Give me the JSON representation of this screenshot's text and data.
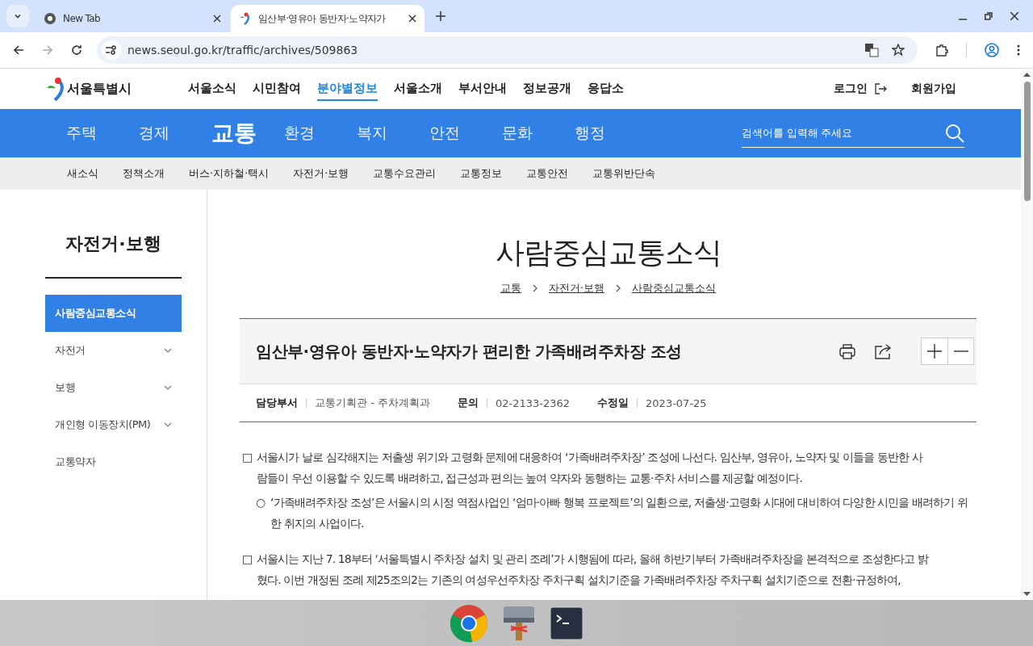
{
  "browser": {
    "tabs": [
      {
        "title": "New Tab",
        "selected": false,
        "kind": "new-tab"
      },
      {
        "title": "임산부·영유아 동반자·노약자가",
        "selected": true,
        "kind": "page"
      }
    ],
    "url": "news.seoul.go.kr/traffic/archives/509863"
  },
  "header": {
    "logo": "서울특별시",
    "nav": [
      {
        "label": "서울소식",
        "selected": false
      },
      {
        "label": "시민참여",
        "selected": false
      },
      {
        "label": "분야별정보",
        "selected": true
      },
      {
        "label": "서울소개",
        "selected": false
      },
      {
        "label": "부서안내",
        "selected": false
      },
      {
        "label": "정보공개",
        "selected": false
      },
      {
        "label": "응답소",
        "selected": false
      }
    ],
    "login": "로그인",
    "signup": "회원가입"
  },
  "category_nav": {
    "items": [
      {
        "label": "주택",
        "selected": false
      },
      {
        "label": "경제",
        "selected": false
      },
      {
        "label": "교통",
        "selected": true
      },
      {
        "label": "환경",
        "selected": false
      },
      {
        "label": "복지",
        "selected": false
      },
      {
        "label": "안전",
        "selected": false
      },
      {
        "label": "문화",
        "selected": false
      },
      {
        "label": "행정",
        "selected": false
      }
    ],
    "search": {
      "placeholder": "검색어를 입력해 주세요"
    }
  },
  "sub_nav": [
    "새소식",
    "정책소개",
    "버스·지하철·택시",
    "자전거·보행",
    "교통수요관리",
    "교통정보",
    "교통안전",
    "교통위반단속"
  ],
  "sidebar": {
    "title": "자전거·보행",
    "items": [
      {
        "label": "사람중심교통소식",
        "selected": true,
        "has_submenu": false
      },
      {
        "label": "자전거",
        "selected": false,
        "has_submenu": true
      },
      {
        "label": "보행",
        "selected": false,
        "has_submenu": true
      },
      {
        "label": "개인형 이동장치(PM)",
        "selected": false,
        "has_submenu": true
      },
      {
        "label": "교통약자",
        "selected": false,
        "has_submenu": false
      }
    ]
  },
  "page": {
    "title": "사람중심교통소식",
    "breadcrumb": [
      "교통",
      "자전거·보행",
      "사람중심교통소식"
    ]
  },
  "article": {
    "title": "임산부·영유아 동반자·노약자가 편리한 가족배려주차장 조성",
    "meta": [
      {
        "label": "담당부서",
        "value": "교통기획관 - 주차계획과"
      },
      {
        "label": "문의",
        "value": "02-2133-2362"
      },
      {
        "label": "수정일",
        "value": "2023-07-25"
      }
    ],
    "paragraphs": [
      {
        "kind": "main",
        "bullet": "□",
        "text": "서울시가 날로 심각해지는 저출생 위기와 고령화 문제에 대응하여 ‘가족배려주차장’ 조성에 나선다. 임산부, 영유아, 노약자 및 이들을 동반한 사람들이 우선 이용할 수 있도록 배려하고, 접근성과 편의는 높여 약자와 동행하는 교통·주차 서비스를 제공할 예정이다."
      },
      {
        "kind": "sub",
        "bullet": "○",
        "text": "‘가족배려주차장 조성’은 서울시의 시정 역점사업인 ‘엄마·아빠 행복 프로젝트’의 일환으로, 저출생·고령화 시대에 대비하여 다양한 시민을 배려하기 위한 취지의 사업이다."
      },
      {
        "kind": "main",
        "bullet": "□",
        "text": "서울시는 지난 7. 18부터 ‘서울특별시 주차장 설치 및 관리 조례’가 시행됨에 따라, 올해 하반기부터 가족배려주차장을 본격적으로 조성한다고 밝혔다. 이번 개정된 조례 제25조의2는 기존의 여성우선주차장 주차구획 설치기준을 가족배려주차장 주차구획 설치기준으로 전환·규정하여,"
      }
    ]
  }
}
